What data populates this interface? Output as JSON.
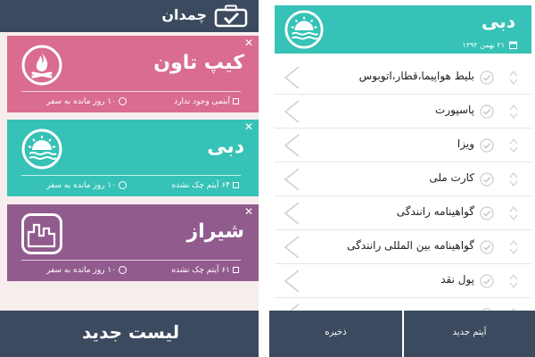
{
  "left": {
    "header": {
      "title": "چمدان",
      "icon": "suitcase-icon"
    },
    "trips": [
      {
        "city": "کیپ تاون",
        "items_text": "آیتمی وجود ندارد",
        "days_text": "۱۰ روز مانده به سفر",
        "color": "#d96c8f",
        "icon": "campfire-icon"
      },
      {
        "city": "دبی",
        "items_text": "۶۴ آیتم چک نشده",
        "days_text": "۱۰ روز مانده به سفر",
        "color": "#36c2b6",
        "icon": "sun-over-sea-icon"
      },
      {
        "city": "شیراز",
        "items_text": "۶۱ آیتم چک نشده",
        "days_text": "۱۰ روز مانده به سفر",
        "color": "#925b8e",
        "icon": "city-skyline-icon"
      }
    ],
    "new_list_label": "لیست جدید"
  },
  "right": {
    "header": {
      "city": "دبی",
      "date": "۲۱ بهمن ۱۳۹۲",
      "color": "#36c2b6"
    },
    "checklist": [
      {
        "label": "بلیط هواپیما،قطار،اتوبوس"
      },
      {
        "label": "پاسپورت"
      },
      {
        "label": "ویزا"
      },
      {
        "label": "کارت ملی"
      },
      {
        "label": "گواهینامه رانندگی"
      },
      {
        "label": "گواهینامه بین المللی رانندگی"
      },
      {
        "label": "پول نقد"
      },
      {
        "label": ""
      }
    ],
    "bottom": {
      "add_label": "آیتم جدید",
      "save_label": "ذخیره"
    }
  },
  "colors": {
    "dark_bar": "#3c4a5f",
    "pink": "#d96c8f",
    "teal": "#36c2b6",
    "purple": "#925b8e"
  }
}
